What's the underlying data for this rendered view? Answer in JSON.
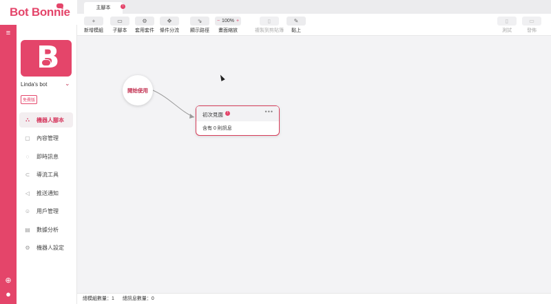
{
  "brand": {
    "name": "Bot Bonnie",
    "accent": "#e4456a"
  },
  "rail": {
    "menu_icon": "≡",
    "globe_icon": "⊕",
    "user_icon": "●"
  },
  "sidebar": {
    "bot_name": "Linda's bot",
    "plan": "免費版",
    "items": [
      {
        "label": "機器人腳本",
        "icon": "⛬",
        "active": true
      },
      {
        "label": "內容管理",
        "icon": "▢",
        "active": false
      },
      {
        "label": "即時訊息",
        "icon": "◌",
        "active": false
      },
      {
        "label": "導流工具",
        "icon": "⊂",
        "active": false
      },
      {
        "label": "推送通知",
        "icon": "◁",
        "active": false
      },
      {
        "label": "用戶管理",
        "icon": "☺",
        "active": false
      },
      {
        "label": "數據分析",
        "icon": "▤",
        "active": false
      },
      {
        "label": "機器人設定",
        "icon": "⚙",
        "active": false
      }
    ]
  },
  "tabs": [
    {
      "label": "主腳本",
      "badge": "!"
    }
  ],
  "toolbar": {
    "new_module": {
      "label": "新增模組",
      "icon": "+"
    },
    "sub_script": {
      "label": "子腳本",
      "icon": "▭"
    },
    "apply_kit": {
      "label": "套用套件",
      "icon": "⚙"
    },
    "condition_branch": {
      "label": "條件分流",
      "icon": "✥"
    },
    "show_path": {
      "label": "顯示路徑",
      "icon": "⇘"
    },
    "zoom": {
      "label": "畫面縮放",
      "value": "100%",
      "minus": "−",
      "plus": "+"
    },
    "copy_to_clipboard": {
      "label": "複製到剪貼簿",
      "icon": "▯"
    },
    "paste": {
      "label": "黏上",
      "icon": "✎"
    },
    "test": {
      "label": "測試",
      "icon": "▯"
    },
    "publish": {
      "label": "發佈",
      "icon": "▭"
    }
  },
  "canvas": {
    "start_node": "開始使用",
    "node": {
      "title": "初次見面",
      "error_badge": "!",
      "more": "•••",
      "body": "含有 0 則訊息"
    }
  },
  "status": {
    "module_count": "總模組數量：1",
    "message_count": "總訊息數量：0"
  }
}
